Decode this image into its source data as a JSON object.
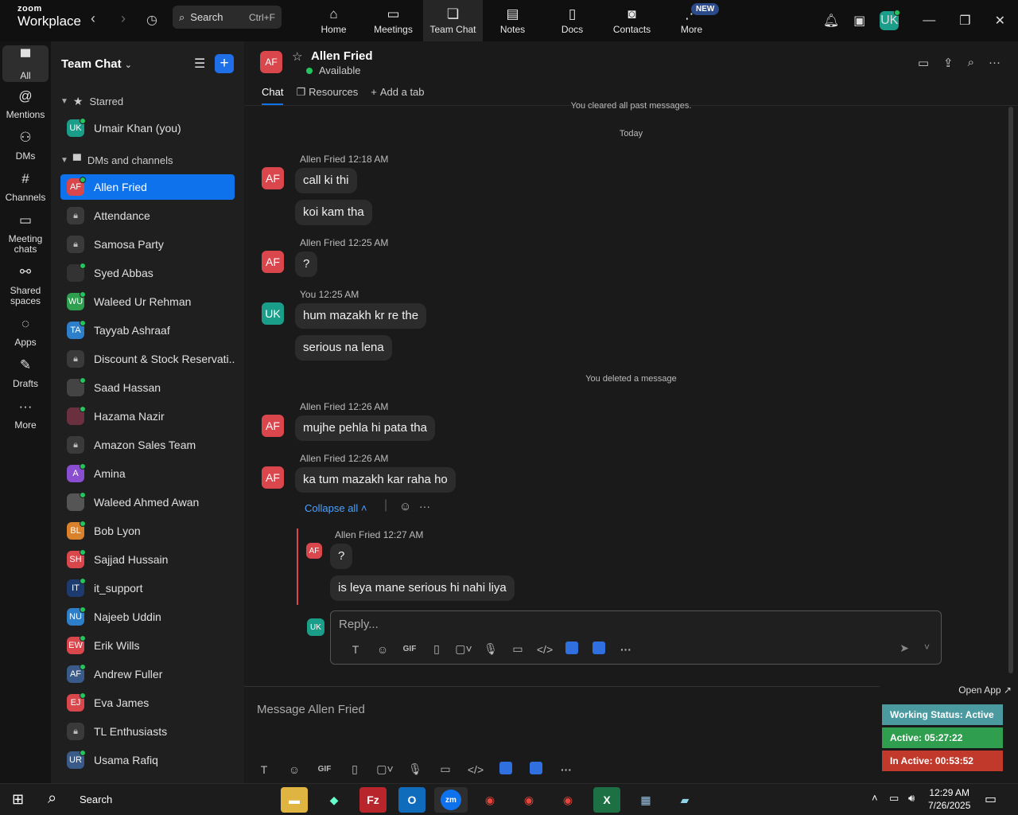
{
  "app": {
    "brand_top": "zoom",
    "brand_bottom": "Workplace"
  },
  "search": {
    "label": "Search",
    "shortcut": "Ctrl+F"
  },
  "top_tabs": [
    {
      "label": "Home",
      "icon": "home-icon"
    },
    {
      "label": "Meetings",
      "icon": "video-icon"
    },
    {
      "label": "Team Chat",
      "icon": "chat-icon"
    },
    {
      "label": "Notes",
      "icon": "notes-icon"
    },
    {
      "label": "Docs",
      "icon": "docs-icon"
    },
    {
      "label": "Contacts",
      "icon": "contacts-icon"
    },
    {
      "label": "More",
      "icon": "more-icon",
      "badge": "NEW"
    }
  ],
  "user": {
    "initials": "UK"
  },
  "rail": [
    {
      "label": "All"
    },
    {
      "label": "Mentions"
    },
    {
      "label": "DMs"
    },
    {
      "label": "Channels"
    },
    {
      "label": "Meeting chats"
    },
    {
      "label": "Shared spaces"
    },
    {
      "label": "Apps"
    },
    {
      "label": "Drafts"
    },
    {
      "label": "More"
    }
  ],
  "sidebar": {
    "title": "Team Chat",
    "starred_label": "Starred",
    "starred": [
      {
        "name": "Umair Khan (you)",
        "initials": "UK",
        "color": "#1a9e8a"
      }
    ],
    "dms_label": "DMs and channels",
    "items": [
      {
        "name": "Allen Fried",
        "initials": "AF",
        "color": "#d9464c",
        "kind": "avatar"
      },
      {
        "name": "Attendance",
        "kind": "lock"
      },
      {
        "name": "Samosa Party",
        "kind": "lock"
      },
      {
        "name": "Syed Abbas",
        "initials": "",
        "color": "#333",
        "kind": "photo"
      },
      {
        "name": "Waleed Ur Rehman",
        "initials": "WU",
        "color": "#2e9e4f",
        "kind": "avatar"
      },
      {
        "name": "Tayyab Ashraaf",
        "initials": "TA",
        "color": "#2d7fc9",
        "kind": "avatar"
      },
      {
        "name": "Discount & Stock Reservati...",
        "kind": "lock"
      },
      {
        "name": "Saad Hassan",
        "initials": "",
        "color": "#444",
        "kind": "photo"
      },
      {
        "name": "Hazama Nazir",
        "initials": "",
        "color": "#6b3040",
        "kind": "photo"
      },
      {
        "name": "Amazon Sales Team",
        "kind": "lock"
      },
      {
        "name": "Amina",
        "initials": "A",
        "color": "#8a4fd0",
        "kind": "avatar"
      },
      {
        "name": "Waleed Ahmed Awan",
        "initials": "",
        "color": "#555",
        "kind": "photo"
      },
      {
        "name": "Bob Lyon",
        "initials": "BL",
        "color": "#d9822b",
        "kind": "avatar"
      },
      {
        "name": "Sajjad Hussain",
        "initials": "SH",
        "color": "#d9464c",
        "kind": "avatar"
      },
      {
        "name": "it_support",
        "initials": "IT",
        "color": "#1d3b6e",
        "kind": "avatar"
      },
      {
        "name": "Najeeb Uddin",
        "initials": "NU",
        "color": "#2d7fc9",
        "kind": "avatar"
      },
      {
        "name": "Erik Wills",
        "initials": "EW",
        "color": "#d9464c",
        "kind": "avatar"
      },
      {
        "name": "Andrew Fuller",
        "initials": "AF",
        "color": "#3a5a8a",
        "kind": "avatar"
      },
      {
        "name": "Eva James",
        "initials": "EJ",
        "color": "#d9464c",
        "kind": "avatar"
      },
      {
        "name": "TL Enthusiasts",
        "kind": "lock"
      },
      {
        "name": "Usama Rafiq",
        "initials": "UR",
        "color": "#3a5a8a",
        "kind": "avatar"
      }
    ]
  },
  "chat": {
    "contact": {
      "name": "Allen Fried",
      "initials": "AF",
      "status": "Available"
    },
    "tabs": [
      {
        "label": "Chat"
      },
      {
        "label": "Resources"
      },
      {
        "label": "Add a tab"
      }
    ],
    "system_cleared": "You cleared all past messages.",
    "date_divider": "Today",
    "system_deleted": "You deleted a message",
    "messages": [
      {
        "meta": "Allen Fried 12:18 AM",
        "initials": "AF",
        "bubbles": [
          "call ki thi",
          "koi kam tha"
        ]
      },
      {
        "meta": "Allen Fried 12:25 AM",
        "initials": "AF",
        "bubbles": [
          "?"
        ]
      },
      {
        "meta": "You 12:25 AM",
        "initials": "UK",
        "bubbles": [
          "hum mazakh kr re the",
          "serious na lena"
        ]
      },
      {
        "meta": "Allen Fried 12:26 AM",
        "initials": "AF",
        "bubbles": [
          "mujhe pehla hi pata tha"
        ]
      },
      {
        "meta": "Allen Fried 12:26 AM",
        "initials": "AF",
        "bubbles": [
          "ka tum mazakh kar raha ho"
        ]
      }
    ],
    "collapse_label": "Collapse all",
    "thread": {
      "meta": "Allen Fried 12:27 AM",
      "initials": "AF",
      "bubbles": [
        "?",
        "is leya mane serious hi nahi liya"
      ]
    },
    "reply_placeholder": "Reply...",
    "composer_placeholder": "Message Allen Fried",
    "gif": "GIF"
  },
  "working_status": {
    "open_app": "Open App ↗",
    "status": "Working Status: Active",
    "active": "Active: 05:27:22",
    "inactive": "In Active: 00:53:52",
    "colors": {
      "status": "#4a9aa0",
      "active": "#2f9e4f",
      "inactive": "#c0392b"
    }
  },
  "taskbar": {
    "search": "Search",
    "time": "12:29 AM",
    "date": "7/26/2025"
  }
}
